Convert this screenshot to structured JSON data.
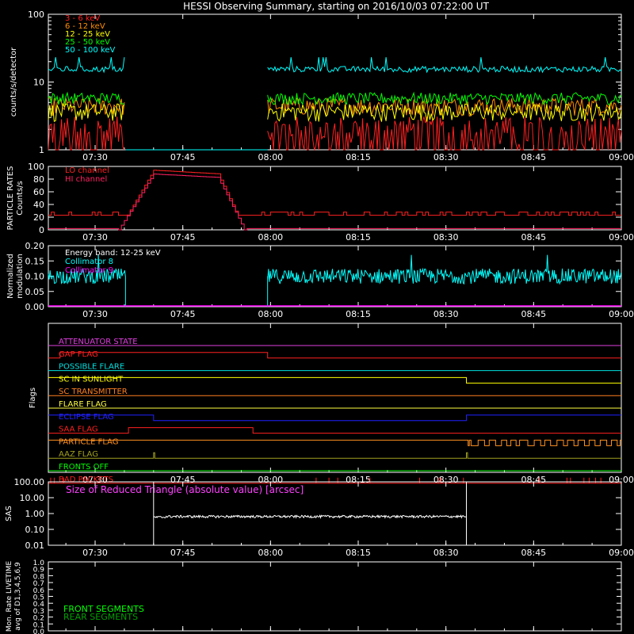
{
  "title": "HESSI Observing Summary, starting on 2016/10/03 07:22:00 UT",
  "time_axis": {
    "start_min": 442,
    "end_min": 540,
    "ticks": [
      {
        "min": 450,
        "label": "07:30"
      },
      {
        "min": 465,
        "label": "07:45"
      },
      {
        "min": 480,
        "label": "08:00"
      },
      {
        "min": 495,
        "label": "08:15"
      },
      {
        "min": 510,
        "label": "08:30"
      },
      {
        "min": 525,
        "label": "08:45"
      },
      {
        "min": 540,
        "label": "09:00"
      }
    ]
  },
  "chart_data": [
    {
      "type": "line",
      "panel": "lightcurve",
      "ylabel": "counts/s/detector",
      "yscale": "log",
      "ylim": [
        1,
        100
      ],
      "yticks": [
        {
          "v": 1,
          "label": "1"
        },
        {
          "v": 10,
          "label": "10"
        },
        {
          "v": 100,
          "label": "100"
        }
      ],
      "legend_placement": "top-left",
      "data_gaps": [
        [
          455.2,
          479.5
        ]
      ],
      "series": [
        {
          "name": "3 - 6 keV",
          "color": "#ff2020",
          "segments": [
            [
              442,
              455.2
            ],
            [
              479.5,
              540
            ]
          ],
          "level": 2.0,
          "noise": 0.55
        },
        {
          "name": "6 - 12 keV",
          "color": "#ff8c00",
          "segments": [
            [
              442,
              455.2
            ],
            [
              479.5,
              540
            ]
          ],
          "level": 4.5,
          "noise": 0.3
        },
        {
          "name": "12 - 25 keV",
          "color": "#ffff00",
          "segments": [
            [
              442,
              455.2
            ],
            [
              479.5,
              540
            ]
          ],
          "level": 3.7,
          "noise": 0.3
        },
        {
          "name": "25 - 50 keV",
          "color": "#00ff00",
          "segments": [
            [
              442,
              455.2
            ],
            [
              479.5,
              540
            ]
          ],
          "level": 5.8,
          "noise": 0.2
        },
        {
          "name": "50 - 100 keV",
          "color": "#00ffff",
          "segments": [
            [
              442,
              455.2
            ],
            [
              479.5,
              540
            ]
          ],
          "level": 15.5,
          "noise": 0.1
        }
      ]
    },
    {
      "type": "line",
      "panel": "particle",
      "ylabel": "PARTICLE RATES Counts/s",
      "yscale": "linear",
      "ylim": [
        0,
        100
      ],
      "yticks": [
        {
          "v": 0,
          "label": "0"
        },
        {
          "v": 20,
          "label": "20"
        },
        {
          "v": 40,
          "label": "40"
        },
        {
          "v": 60,
          "label": "60"
        },
        {
          "v": 80,
          "label": "80"
        },
        {
          "v": 100,
          "label": "100"
        }
      ],
      "legend_placement": "top-left",
      "series": [
        {
          "name": "LO channel",
          "color": "#ff2020",
          "baseline": 23,
          "peak": 94
        },
        {
          "name": "HI channel",
          "color": "#ff2060",
          "baseline": 2,
          "peak": 88
        }
      ]
    },
    {
      "type": "line",
      "panel": "modulation",
      "ylabel": "Normalized modulation",
      "yscale": "linear",
      "ylim": [
        0,
        0.2
      ],
      "yticks": [
        {
          "v": 0,
          "label": "0.00"
        },
        {
          "v": 0.05,
          "label": "0.05"
        },
        {
          "v": 0.1,
          "label": "0.10"
        },
        {
          "v": 0.15,
          "label": "0.15"
        },
        {
          "v": 0.2,
          "label": "0.20"
        }
      ],
      "annotation": "Energy band: 12-25 keV",
      "series": [
        {
          "name": "Collimator 8",
          "color": "#00ffff",
          "segments": [
            [
              442,
              455.2
            ],
            [
              479.5,
              540
            ]
          ],
          "level": 0.1
        },
        {
          "name": "Collimator 9",
          "color": "#ff00ff",
          "level": 0.0
        }
      ]
    },
    {
      "type": "line",
      "panel": "flags",
      "ylabel": "Flags",
      "series": [
        {
          "name": "ATTENUATOR STATE",
          "color": "#e040e0",
          "steps": [
            [
              442,
              0
            ]
          ]
        },
        {
          "name": "GAP FLAG",
          "color": "#ff2020",
          "steps": [
            [
              442,
              0
            ],
            [
              444,
              1
            ],
            [
              479.5,
              0
            ]
          ]
        },
        {
          "name": "POSSIBLE FLARE",
          "color": "#00e0e0",
          "steps": [
            [
              442,
              0
            ]
          ]
        },
        {
          "name": "SC IN SUNLIGHT",
          "color": "#ffff00",
          "steps": [
            [
              442,
              1
            ],
            [
              513.5,
              0
            ]
          ]
        },
        {
          "name": "SC TRANSMITTER",
          "color": "#ff8020",
          "steps": [
            [
              442,
              0
            ]
          ]
        },
        {
          "name": "FLARE FLAG",
          "color": "#ffff40",
          "steps": [
            [
              442,
              0
            ]
          ]
        },
        {
          "name": "ECLIPSE FLAG",
          "color": "#2020ff",
          "steps": [
            [
              442,
              1
            ],
            [
              460,
              0
            ],
            [
              513.5,
              1
            ]
          ]
        },
        {
          "name": "SAA FLAG",
          "color": "#ff2020",
          "steps": [
            [
              442,
              0
            ],
            [
              455.7,
              1
            ],
            [
              477,
              0
            ]
          ]
        },
        {
          "name": "PARTICLE FLAG",
          "color": "#ff9020",
          "steps": [
            [
              442,
              1
            ],
            [
              513.8,
              0
            ],
            [
              514,
              1
            ],
            [
              514.3,
              0
            ],
            [
              515.5,
              1
            ],
            [
              516.6,
              0
            ],
            [
              517.4,
              1
            ],
            [
              518.5,
              0
            ],
            [
              519.5,
              1
            ],
            [
              520.4,
              0
            ],
            [
              521.1,
              1
            ],
            [
              522,
              0
            ],
            [
              522.6,
              1
            ],
            [
              524,
              0
            ],
            [
              525.1,
              1
            ],
            [
              526.2,
              0
            ],
            [
              526.9,
              1
            ],
            [
              527.9,
              0
            ],
            [
              529,
              1
            ],
            [
              530.1,
              0
            ],
            [
              530.8,
              1
            ],
            [
              531.9,
              0
            ],
            [
              532.6,
              1
            ],
            [
              533.7,
              0
            ],
            [
              534.5,
              1
            ],
            [
              535.5,
              0
            ],
            [
              536.4,
              1
            ],
            [
              537.5,
              0
            ],
            [
              538.3,
              1
            ],
            [
              539.3,
              0
            ],
            [
              539.8,
              1
            ]
          ]
        },
        {
          "name": "AAZ FLAG",
          "color": "#a0a020",
          "steps": [
            [
              442,
              0
            ],
            [
              460,
              1
            ],
            [
              460.2,
              0
            ],
            [
              513.5,
              1
            ],
            [
              513.7,
              0
            ]
          ]
        },
        {
          "name": "FRONTS OFF",
          "color": "#00ff00",
          "steps": [
            [
              442,
              0
            ]
          ]
        },
        {
          "name": "BAD PACKETS",
          "color": "#ff2020",
          "spikes": [
            442.4,
            443,
            444.6,
            487.8,
            490,
            491.5,
            497,
            505.5,
            508.7,
            509.2,
            513,
            526,
            530.7,
            531.3,
            533.6,
            534.5,
            535.6,
            536.5
          ]
        }
      ]
    },
    {
      "type": "line",
      "panel": "sas",
      "ylabel": "SAS",
      "yscale": "log",
      "ylim": [
        0.01,
        100
      ],
      "yticks": [
        {
          "v": 0.01,
          "label": "0.01"
        },
        {
          "v": 0.1,
          "label": "0.10"
        },
        {
          "v": 1,
          "label": "1.00"
        },
        {
          "v": 10,
          "label": "10.00"
        },
        {
          "v": 100,
          "label": "100.00"
        }
      ],
      "series": [
        {
          "name": "Size of Reduced Triangle (absolute value) [arcsec]",
          "color": "#ff40ff",
          "segment": [
            460,
            513.5
          ],
          "level": 0.65
        }
      ]
    },
    {
      "type": "line",
      "panel": "livetime",
      "ylabel": "Mon. Rate LIVETIME avg of D1,3,4,5,6,9",
      "yscale": "linear",
      "ylim": [
        0,
        1
      ],
      "yticks": [
        {
          "v": 0,
          "label": "0.0"
        },
        {
          "v": 0.1,
          "label": "0.1"
        },
        {
          "v": 0.2,
          "label": "0.2"
        },
        {
          "v": 0.3,
          "label": "0.3"
        },
        {
          "v": 0.4,
          "label": "0.4"
        },
        {
          "v": 0.5,
          "label": "0.5"
        },
        {
          "v": 0.6,
          "label": "0.6"
        },
        {
          "v": 0.7,
          "label": "0.7"
        },
        {
          "v": 0.8,
          "label": "0.8"
        },
        {
          "v": 0.9,
          "label": "0.9"
        },
        {
          "v": 1.0,
          "label": "1.0"
        }
      ],
      "legend_placement": "bottom-left",
      "series": [
        {
          "name": "FRONT SEGMENTS",
          "color": "#00ff00"
        },
        {
          "name": "REAR SEGMENTS",
          "color": "#00a000"
        }
      ]
    }
  ]
}
